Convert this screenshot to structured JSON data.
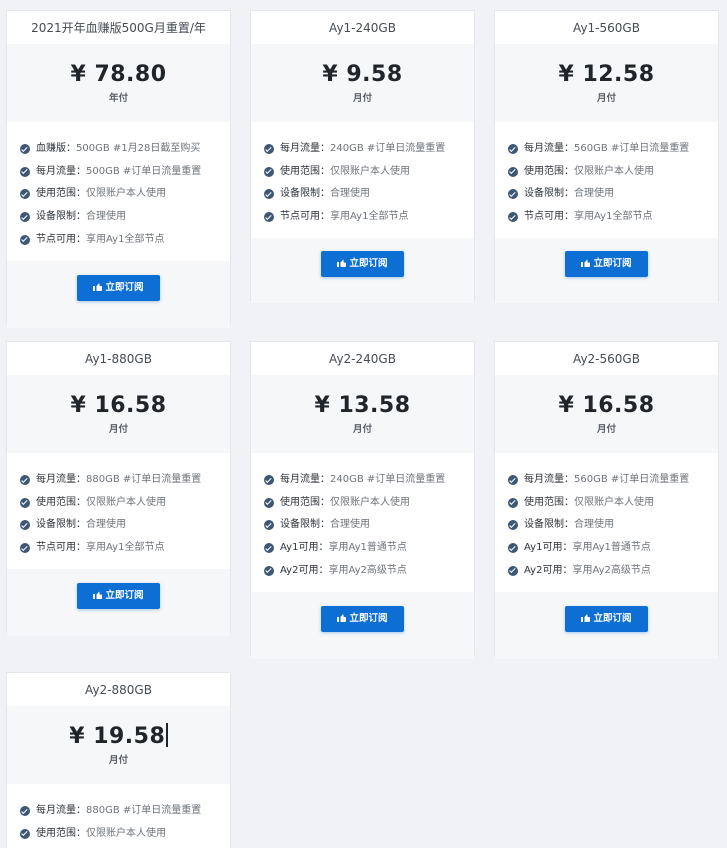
{
  "currency": "¥",
  "button_label": "立即订阅",
  "plans": [
    {
      "title": "2021开年血赚版500G月重置/年",
      "price": "78.80",
      "cycle": "年付",
      "features": [
        {
          "key": "血赚版：",
          "value": "500GB #1月28日截至购买"
        },
        {
          "key": "每月流量：",
          "value": "500GB #订单日流量重置"
        },
        {
          "key": "使用范围：",
          "value": "仅限账户本人使用"
        },
        {
          "key": "设备限制：",
          "value": "合理使用"
        },
        {
          "key": "节点可用：",
          "value": "享用Ay1全部节点"
        }
      ]
    },
    {
      "title": "Ay1-240GB",
      "price": "9.58",
      "cycle": "月付",
      "features": [
        {
          "key": "每月流量：",
          "value": "240GB #订单日流量重置"
        },
        {
          "key": "使用范围：",
          "value": "仅限账户本人使用"
        },
        {
          "key": "设备限制：",
          "value": "合理使用"
        },
        {
          "key": "节点可用：",
          "value": "享用Ay1全部节点"
        }
      ]
    },
    {
      "title": "Ay1-560GB",
      "price": "12.58",
      "cycle": "月付",
      "features": [
        {
          "key": "每月流量：",
          "value": "560GB #订单日流量重置"
        },
        {
          "key": "使用范围：",
          "value": "仅限账户本人使用"
        },
        {
          "key": "设备限制：",
          "value": "合理使用"
        },
        {
          "key": "节点可用：",
          "value": "享用Ay1全部节点"
        }
      ]
    },
    {
      "title": "Ay1-880GB",
      "price": "16.58",
      "cycle": "月付",
      "features": [
        {
          "key": "每月流量：",
          "value": "880GB #订单日流量重置"
        },
        {
          "key": "使用范围：",
          "value": "仅限账户本人使用"
        },
        {
          "key": "设备限制：",
          "value": "合理使用"
        },
        {
          "key": "节点可用：",
          "value": "享用Ay1全部节点"
        }
      ]
    },
    {
      "title": "Ay2-240GB",
      "price": "13.58",
      "cycle": "月付",
      "features": [
        {
          "key": "每月流量：",
          "value": "240GB #订单日流量重置"
        },
        {
          "key": "使用范围：",
          "value": "仅限账户本人使用"
        },
        {
          "key": "设备限制：",
          "value": "合理使用"
        },
        {
          "key": "Ay1可用：",
          "value": "享用Ay1普通节点"
        },
        {
          "key": "Ay2可用：",
          "value": "享用Ay2高级节点"
        }
      ]
    },
    {
      "title": "Ay2-560GB",
      "price": "16.58",
      "cycle": "月付",
      "features": [
        {
          "key": "每月流量：",
          "value": "560GB #订单日流量重置"
        },
        {
          "key": "使用范围：",
          "value": "仅限账户本人使用"
        },
        {
          "key": "设备限制：",
          "value": "合理使用"
        },
        {
          "key": "Ay1可用：",
          "value": "享用Ay1普通节点"
        },
        {
          "key": "Ay2可用：",
          "value": "享用Ay2高级节点"
        }
      ]
    },
    {
      "title": "Ay2-880GB",
      "price": "19.58",
      "cycle": "月付",
      "features": [
        {
          "key": "每月流量：",
          "value": "880GB #订单日流量重置"
        },
        {
          "key": "使用范围：",
          "value": "仅限账户本人使用"
        }
      ]
    }
  ]
}
